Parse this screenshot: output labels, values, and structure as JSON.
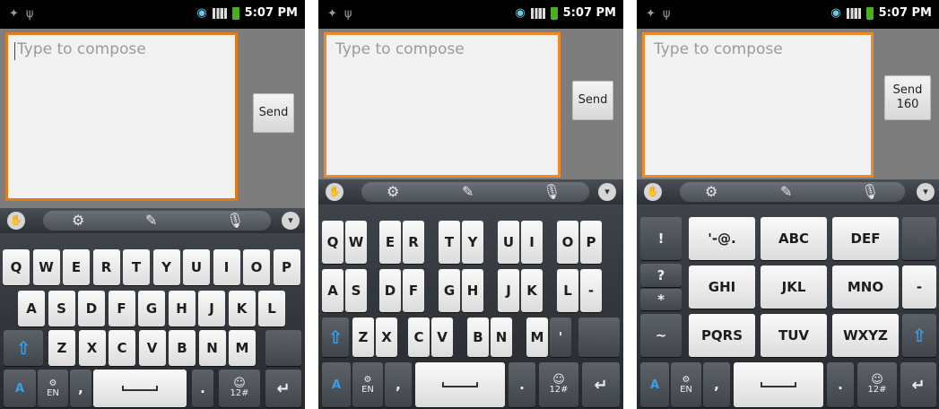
{
  "status": {
    "time": "5:07 PM",
    "left_icons": [
      "android-debug-icon",
      "usb-icon"
    ],
    "right_icons": [
      "wifi-icon",
      "signal-icon",
      "battery-icon"
    ]
  },
  "compose": {
    "placeholder": "Type to compose"
  },
  "send": {
    "label": "Send",
    "label3_line1": "Send",
    "label3_line2": "160"
  },
  "toolbar": {
    "icons": [
      "swipe-icon",
      "gear-icon",
      "edit-icon",
      "mic-icon",
      "chevron-down-icon"
    ],
    "glyphs": {
      "swipe": "✋",
      "gear": "⚙",
      "edit": "✎",
      "mic": "🎙",
      "down": "▾"
    }
  },
  "kb1": {
    "row1": [
      "Q",
      "W",
      "E",
      "R",
      "T",
      "Y",
      "U",
      "I",
      "O",
      "P"
    ],
    "row2": [
      "A",
      "S",
      "D",
      "F",
      "G",
      "H",
      "J",
      "K",
      "L"
    ],
    "row3": [
      "Z",
      "X",
      "C",
      "V",
      "B",
      "N",
      "M"
    ]
  },
  "kb2": {
    "row1": [
      "Q",
      "W",
      "E",
      "R",
      "T",
      "Y",
      "U",
      "I",
      "O",
      "P"
    ],
    "row2": [
      "A",
      "S",
      "D",
      "F",
      "G",
      "H",
      "J",
      "K",
      "L",
      "-"
    ],
    "row3": [
      "Z",
      "X",
      "C",
      "V",
      "B",
      "N",
      "M",
      "'"
    ]
  },
  "kb3": {
    "side": [
      "!",
      "?",
      "*",
      "~"
    ],
    "grid": [
      "'-@.",
      "ABC",
      "DEF",
      "GHI",
      "JKL",
      "MNO",
      "PQRS",
      "TUV",
      "WXYZ"
    ],
    "right": [
      "-"
    ]
  },
  "bottom": {
    "lang_top": "⚙",
    "lang_bottom": "EN",
    "comma": ",",
    "period": ".",
    "sym_top": "☺",
    "sym_bottom": "12#",
    "enter": "↵",
    "del": "⌫",
    "shift": "⇧",
    "mode": "A"
  }
}
